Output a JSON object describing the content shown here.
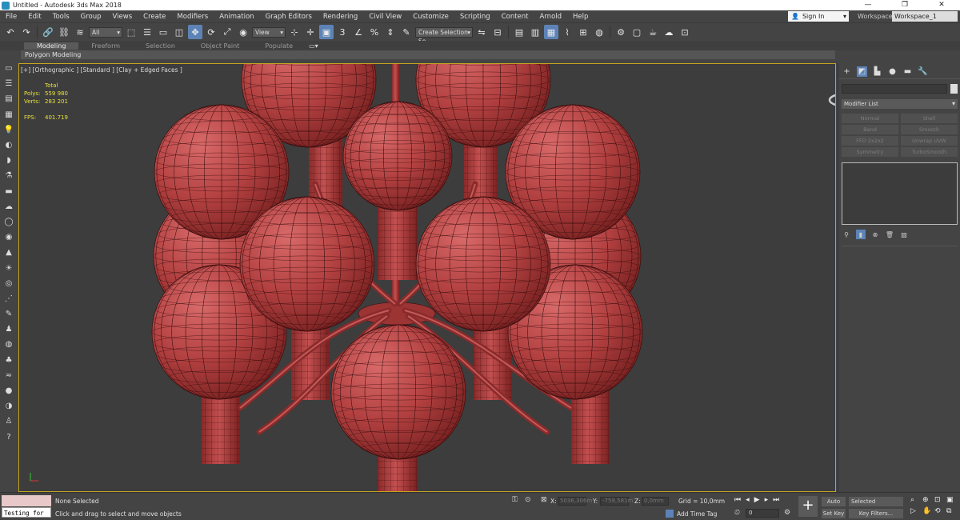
{
  "window": {
    "title": "Untitled - Autodesk 3ds Max 2018",
    "controls": [
      "—",
      "❐",
      "✕"
    ]
  },
  "menu": {
    "items": [
      "File",
      "Edit",
      "Tools",
      "Group",
      "Views",
      "Create",
      "Modifiers",
      "Animation",
      "Graph Editors",
      "Rendering",
      "Civil View",
      "Customize",
      "Scripting",
      "Content",
      "Arnold",
      "Help"
    ],
    "sign_in": "Sign In",
    "workspaces_label": "Workspaces:",
    "workspace_value": "Workspace_1"
  },
  "toolbar": {
    "filter_value": "All",
    "ref_coord_value": "View",
    "selection_set_placeholder": "Create Selection Se"
  },
  "ribbon": {
    "tabs": [
      "Modeling",
      "Freeform",
      "Selection",
      "Object Paint",
      "Populate"
    ],
    "active_tab": "Modeling",
    "sub_label": "Polygon Modeling"
  },
  "viewport": {
    "label": "[+] [Orthographic ] [Standard ] [Clay + Edged Faces ]",
    "stats": {
      "header": "Total",
      "polys_label": "Polys:",
      "polys_value": "559 980",
      "verts_label": "Verts:",
      "verts_value": "283 201",
      "fps_label": "FPS:",
      "fps_value": "401.719"
    },
    "mesh_color": "#b24040",
    "background": "#3d3d3d",
    "border_color": "#c7a520"
  },
  "command_panel": {
    "modifier_list_label": "Modifier List",
    "modifier_buttons": [
      "Normal",
      "Shell",
      "Bend",
      "Smooth",
      "FFD 2x2x2",
      "Unwrap UVW",
      "Symmetry",
      "TurboSmooth"
    ]
  },
  "status": {
    "maxscript_value": "Testing for :",
    "selection_status": "None Selected",
    "prompt": "Click and drag to select and move objects",
    "x_label": "X:",
    "x_value": "5036,306m",
    "y_label": "Y:",
    "y_value": "-759,581m",
    "z_label": "Z:",
    "z_value": "0,0mm",
    "grid": "Grid = 10,0mm",
    "add_time_tag": "Add Time Tag",
    "frame_value": "0",
    "auto_key": "Auto Key",
    "set_key": "Set Key",
    "key_selected": "Selected",
    "key_filters": "Key Filters..."
  }
}
